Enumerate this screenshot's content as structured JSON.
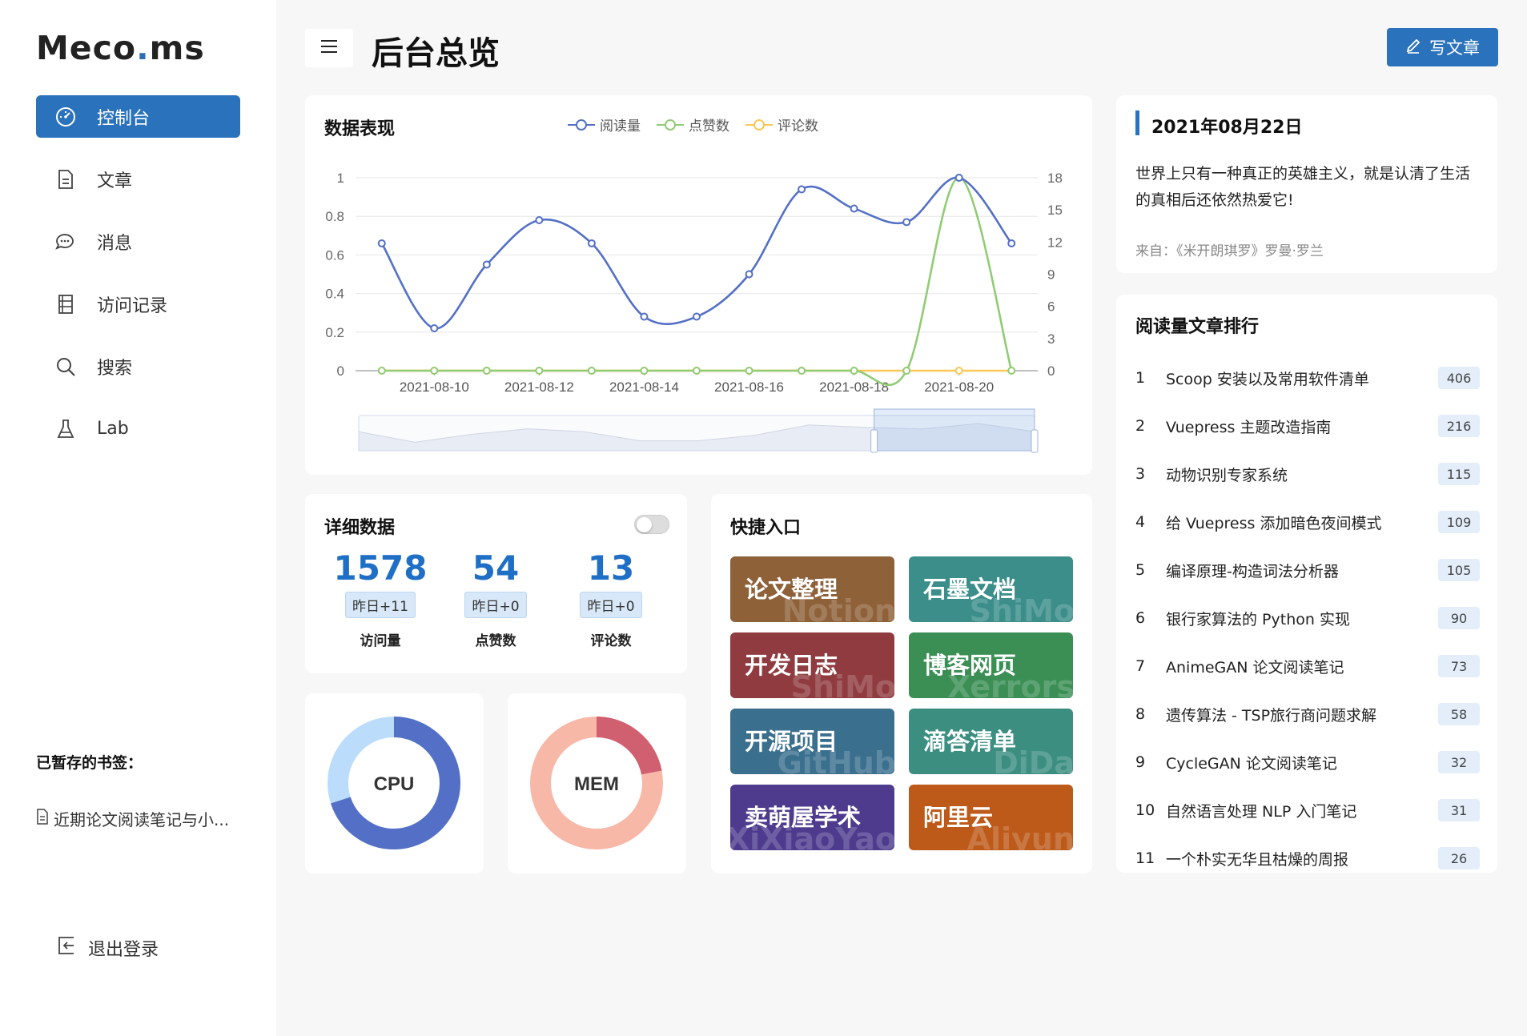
{
  "app": {
    "logo_main": "Meco",
    "logo_dot": ".",
    "logo_tail": "ms"
  },
  "sidebar": {
    "items": [
      {
        "label": "控制台",
        "icon": "dashboard-gauge-icon"
      },
      {
        "label": "文章",
        "icon": "document-icon"
      },
      {
        "label": "消息",
        "icon": "chat-bubbles-icon"
      },
      {
        "label": "访问记录",
        "icon": "log-list-icon"
      },
      {
        "label": "搜索",
        "icon": "search-icon"
      },
      {
        "label": "Lab",
        "icon": "flask-icon"
      }
    ],
    "bookmarks_title": "已暂存的书签：",
    "bookmark": "近期论文阅读笔记与小...",
    "logout": "退出登录"
  },
  "header": {
    "title": "后台总览",
    "write_label": "写文章"
  },
  "chart_card": {
    "title": "数据表现"
  },
  "chart_data": {
    "type": "line",
    "x": [
      "2021-08-09",
      "2021-08-10",
      "2021-08-11",
      "2021-08-12",
      "2021-08-13",
      "2021-08-14",
      "2021-08-15",
      "2021-08-16",
      "2021-08-17",
      "2021-08-18",
      "2021-08-19",
      "2021-08-20",
      "2021-08-21"
    ],
    "x_ticks": [
      "2021-08-10",
      "2021-08-12",
      "2021-08-14",
      "2021-08-16",
      "2021-08-18",
      "2021-08-20"
    ],
    "series": [
      {
        "name": "阅读量",
        "axis": "left",
        "color": "#5470c6",
        "values": [
          0.66,
          0.22,
          0.55,
          0.78,
          0.66,
          0.28,
          0.28,
          0.5,
          0.94,
          0.84,
          0.77,
          1.0,
          0.66
        ]
      },
      {
        "name": "点赞数",
        "axis": "right",
        "color": "#91cc75",
        "values": [
          0,
          0,
          0,
          0,
          0,
          0,
          0,
          0,
          0,
          0,
          0,
          18,
          0
        ]
      },
      {
        "name": "评论数",
        "axis": "right",
        "color": "#fac858",
        "values": [
          0,
          0,
          0,
          0,
          0,
          0,
          0,
          0,
          0,
          0,
          0,
          0,
          0
        ]
      }
    ],
    "y_left": {
      "ticks": [
        "0",
        "0.2",
        "0.4",
        "0.6",
        "0.8",
        "1"
      ],
      "range": [
        0,
        1
      ]
    },
    "y_right": {
      "ticks": [
        "0",
        "3",
        "6",
        "9",
        "12",
        "15",
        "18"
      ],
      "range": [
        0,
        18
      ]
    },
    "legend_position": "top",
    "grid": true,
    "data_zoom": true
  },
  "detail": {
    "title": "详细数据",
    "stats": [
      {
        "value": "1578",
        "delta": "昨日+11",
        "label": "访问量"
      },
      {
        "value": "54",
        "delta": "昨日+0",
        "label": "点赞数"
      },
      {
        "value": "13",
        "delta": "昨日+0",
        "label": "评论数"
      }
    ]
  },
  "gauges": [
    {
      "label": "CPU",
      "usage": 0.7,
      "color_used": "#5470c6",
      "color_free": "#bcdcfb"
    },
    {
      "label": "MEM",
      "usage": 0.22,
      "color_used": "#d0606f",
      "color_free": "#f8b8a8"
    }
  ],
  "quick": {
    "title": "快捷入口",
    "links": [
      {
        "label": "论文整理",
        "watermark": "Notion",
        "color": "#8e6139"
      },
      {
        "label": "石墨文档",
        "watermark": "ShiMo",
        "color": "#3b8e8a"
      },
      {
        "label": "开发日志",
        "watermark": "ShiMo",
        "color": "#8f3b40"
      },
      {
        "label": "博客网页",
        "watermark": "Xerrors",
        "color": "#3b8f55"
      },
      {
        "label": "开源项目",
        "watermark": "GitHub",
        "color": "#3b6f8e"
      },
      {
        "label": "滴答清单",
        "watermark": "DiDa",
        "color": "#3b8e80"
      },
      {
        "label": "卖萌屋学术",
        "watermark": "XiXiaoYao",
        "color": "#4f3b8e"
      },
      {
        "label": "阿里云",
        "watermark": "Aliyun",
        "color": "#bd5a1a"
      }
    ]
  },
  "quote": {
    "date": "2021年08月22日",
    "text": "世界上只有一种真正的英雄主义，就是认清了生活的真相后还依然热爱它!",
    "source": "来自：《米开朗琪罗》罗曼·罗兰"
  },
  "rank": {
    "title": "阅读量文章排行",
    "items": [
      {
        "idx": "1",
        "title": "Scoop 安装以及常用软件清单",
        "count": "406"
      },
      {
        "idx": "2",
        "title": "Vuepress 主题改造指南",
        "count": "216"
      },
      {
        "idx": "3",
        "title": "动物识别专家系统",
        "count": "115"
      },
      {
        "idx": "4",
        "title": "给 Vuepress 添加暗色夜间模式",
        "count": "109"
      },
      {
        "idx": "5",
        "title": "编译原理-构造词法分析器",
        "count": "105"
      },
      {
        "idx": "6",
        "title": "银行家算法的 Python 实现",
        "count": "90"
      },
      {
        "idx": "7",
        "title": "AnimeGAN 论文阅读笔记",
        "count": "73"
      },
      {
        "idx": "8",
        "title": "遗传算法 - TSP旅行商问题求解",
        "count": "58"
      },
      {
        "idx": "9",
        "title": "CycleGAN 论文阅读笔记",
        "count": "32"
      },
      {
        "idx": "10",
        "title": "自然语言处理 NLP 入门笔记",
        "count": "31"
      },
      {
        "idx": "11",
        "title": "一个朴实无华且枯燥的周报",
        "count": "26"
      }
    ]
  }
}
